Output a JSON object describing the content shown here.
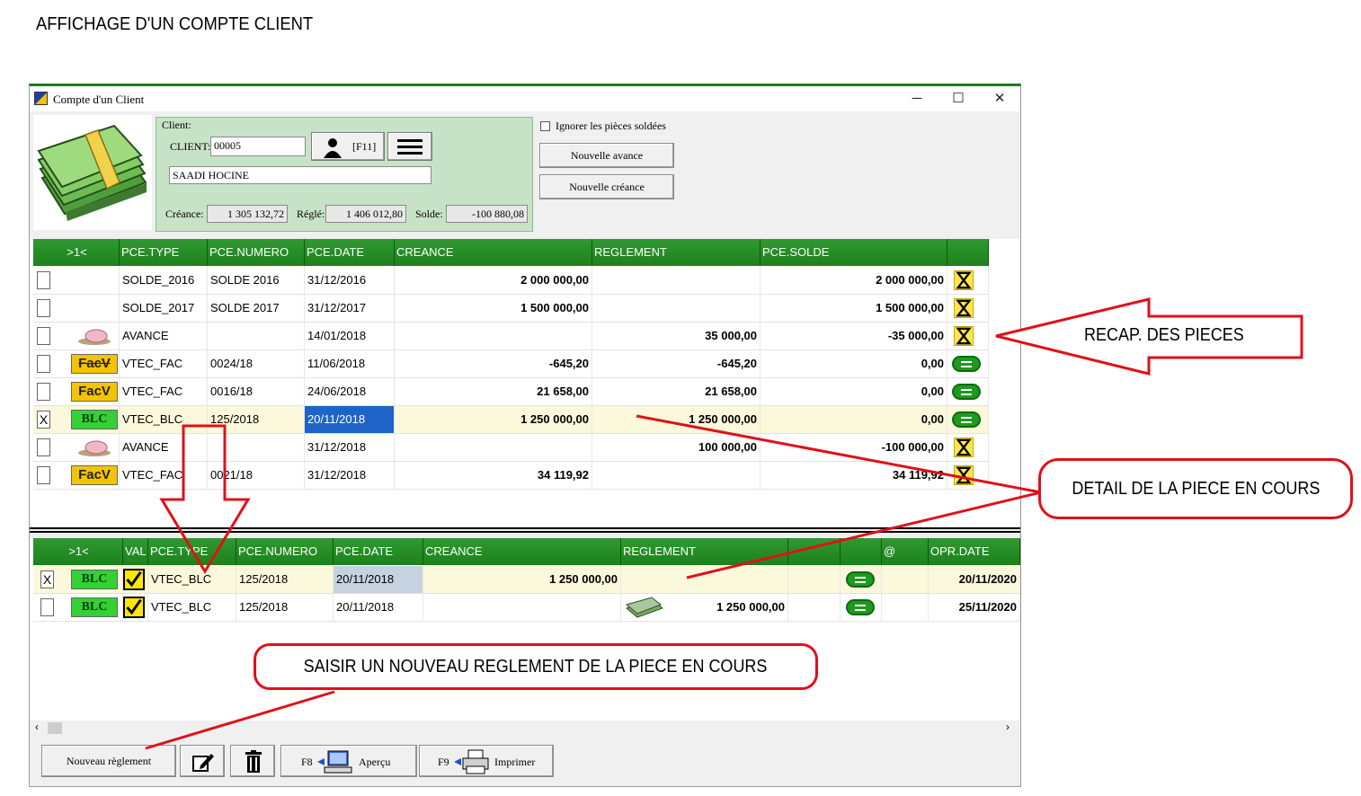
{
  "page_title": "AFFICHAGE D'UN COMPTE CLIENT",
  "window": {
    "title": "Compte d'un Client",
    "buttons": {
      "minimize": "─",
      "maximize": "☐",
      "close": "✕"
    }
  },
  "client": {
    "group_label": "Client:",
    "client_label": "CLIENT:",
    "client_code": "00005",
    "f11_label": "[F11]",
    "client_name": "SAADI HOCINE",
    "creance_label": "Créance:",
    "creance_value": "1 305 132,72",
    "regle_label": "Réglé:",
    "regle_value": "1 406 012,80",
    "solde_label": "Solde:",
    "solde_value": "-100 880,08"
  },
  "options": {
    "ignore_label": "Ignorer les pièces soldées",
    "nouvelle_avance": "Nouvelle avance",
    "nouvelle_creance": "Nouvelle créance"
  },
  "grid1": {
    "headers": [
      ">1<",
      "PCE.TYPE",
      "PCE.NUMERO",
      "PCE.DATE",
      "CREANCE",
      "REGLEMENT",
      "PCE.SOLDE",
      ""
    ],
    "rows": [
      {
        "check": "",
        "icon": "",
        "type": "SOLDE_2016",
        "numero": "SOLDE 2016",
        "date": "31/12/2016",
        "creance": "2 000 000,00",
        "reglement": "",
        "solde": "2 000 000,00",
        "status": "hourglass"
      },
      {
        "check": "",
        "icon": "",
        "type": "SOLDE_2017",
        "numero": "SOLDE 2017",
        "date": "31/12/2017",
        "creance": "1 500 000,00",
        "reglement": "",
        "solde": "1 500 000,00",
        "status": "hourglass"
      },
      {
        "check": "",
        "icon": "piggy",
        "type": "AVANCE",
        "numero": "",
        "date": "14/01/2018",
        "creance": "",
        "reglement": "35 000,00",
        "solde": "-35 000,00",
        "status": "hourglass"
      },
      {
        "check": "",
        "icon": "facv-back",
        "icon_text": "FacV",
        "type": "VTEC_FAC",
        "numero": "0024/18",
        "date": "11/06/2018",
        "creance": "-645,20",
        "reglement": "-645,20",
        "solde": "0,00",
        "status": "equal"
      },
      {
        "check": "",
        "icon": "facv",
        "icon_text": "FacV",
        "type": "VTEC_FAC",
        "numero": "0016/18",
        "date": "24/06/2018",
        "creance": "21 658,00",
        "reglement": "21 658,00",
        "solde": "0,00",
        "status": "equal"
      },
      {
        "check": "X",
        "icon": "blc",
        "icon_text": "BLC",
        "type": "VTEC_BLC",
        "numero": "125/2018",
        "date": "20/11/2018",
        "creance": "1 250 000,00",
        "reglement": "1 250 000,00",
        "solde": "0,00",
        "status": "equal",
        "selected": true
      },
      {
        "check": "",
        "icon": "piggy",
        "type": "AVANCE",
        "numero": "",
        "date": "31/12/2018",
        "creance": "",
        "reglement": "100 000,00",
        "solde": "-100 000,00",
        "status": "hourglass"
      },
      {
        "check": "",
        "icon": "facv",
        "icon_text": "FacV",
        "type": "VTEC_FAC",
        "numero": "0021/18",
        "date": "31/12/2018",
        "creance": "34 119,92",
        "reglement": "",
        "solde": "34 119,92",
        "status": "hourglass"
      }
    ]
  },
  "grid2": {
    "headers": [
      ">1<",
      "VAL",
      "PCE.TYPE",
      "PCE.NUMERO",
      "PCE.DATE",
      "CREANCE",
      "REGLEMENT",
      "",
      "",
      "@",
      "OPR.DATE"
    ],
    "rows": [
      {
        "check": "X",
        "icon_text": "BLC",
        "type": "VTEC_BLC",
        "numero": "125/2018",
        "date": "20/11/2018",
        "creance": "1 250 000,00",
        "reglement": "",
        "opr_date": "20/11/2020",
        "selected": true
      },
      {
        "check": "",
        "icon_text": "BLC",
        "type": "VTEC_BLC",
        "numero": "125/2018",
        "date": "20/11/2018",
        "creance": "",
        "reglement": "1 250 000,00",
        "opr_date": "25/11/2020"
      }
    ]
  },
  "toolbar": {
    "nouveau_reglement": "Nouveau règlement",
    "f8": "F8",
    "apercu": "Aperçu",
    "f9": "F9",
    "imprimer": "Imprimer"
  },
  "callouts": {
    "recap": "RECAP. DES PIECES",
    "detail": "DETAIL DE LA PIECE EN COURS",
    "saisir": "SAISIR UN NOUVEAU REGLEMENT DE LA PIECE EN COURS"
  },
  "colors": {
    "header_green": "#1e801e",
    "callout_red": "#e0101a",
    "panel_green": "#c7e3c7"
  }
}
